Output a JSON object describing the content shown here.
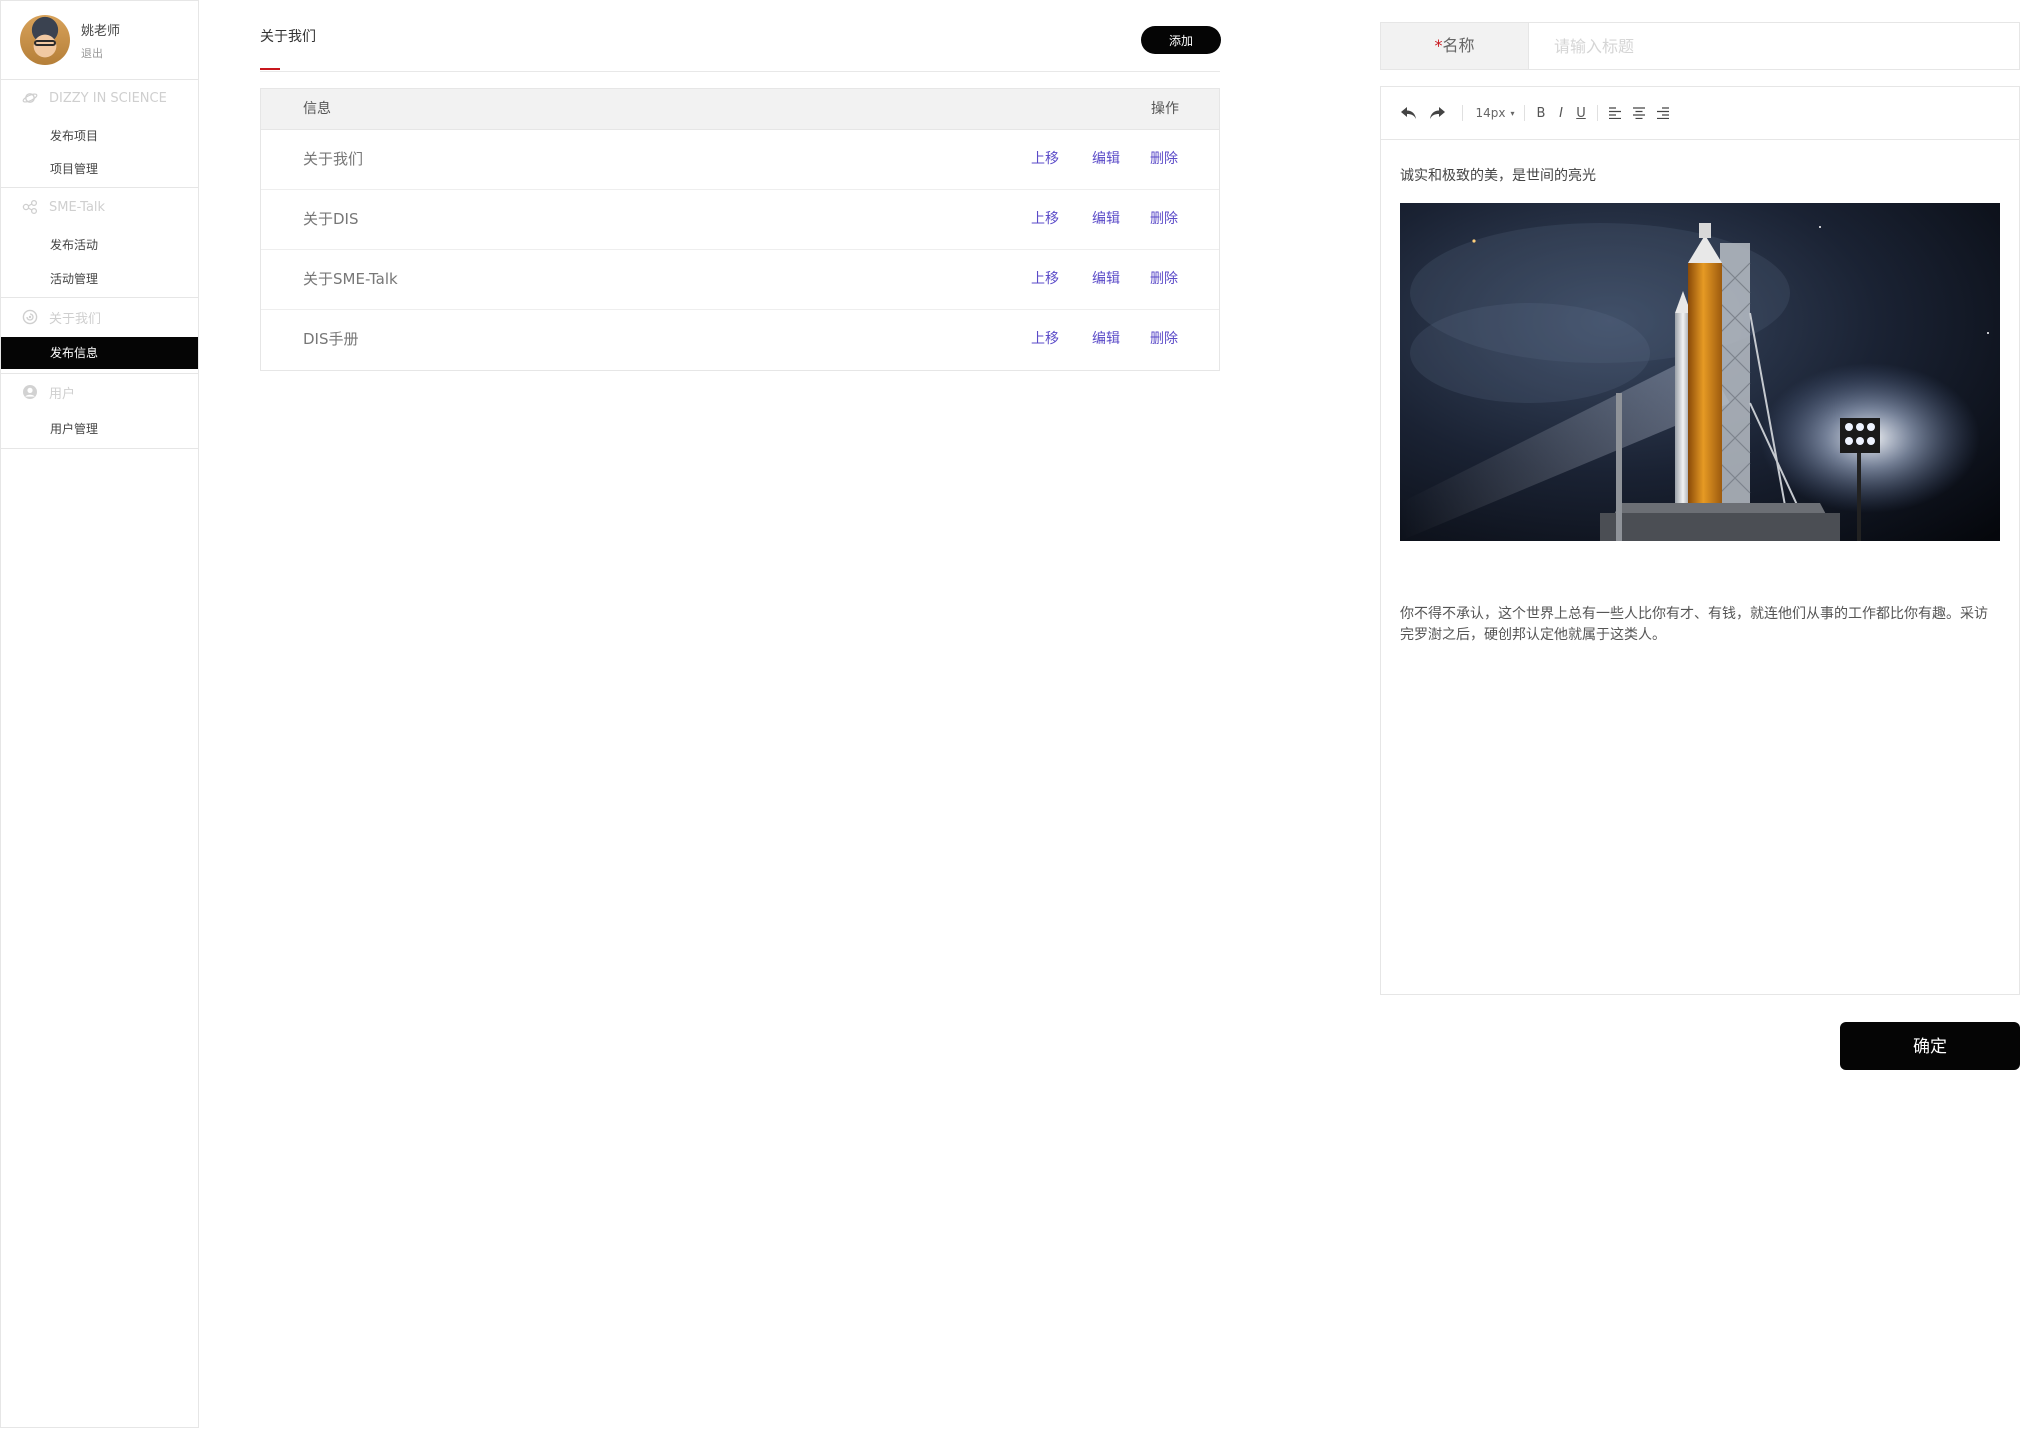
{
  "user": {
    "name": "姚老师",
    "logout": "退出"
  },
  "sidebar": {
    "sections": [
      {
        "title": "DIZZY IN SCIENCE",
        "icon": "planet-icon",
        "items": [
          {
            "label": "发布项目"
          },
          {
            "label": "项目管理"
          }
        ]
      },
      {
        "title": "SME-Talk",
        "icon": "share-icon",
        "items": [
          {
            "label": "发布活动"
          },
          {
            "label": "活动管理"
          }
        ]
      },
      {
        "title": "关于我们",
        "icon": "info-circle-icon",
        "items": [
          {
            "label": "发布信息",
            "active": true
          }
        ]
      },
      {
        "title": "用户",
        "icon": "user-icon",
        "items": [
          {
            "label": "用户管理"
          }
        ]
      }
    ]
  },
  "main": {
    "title": "关于我们",
    "add_label": "添加",
    "table": {
      "col_info": "信息",
      "col_op": "操作",
      "rows": [
        {
          "label": "关于我们",
          "up": "上移",
          "edit": "编辑",
          "delete": "删除"
        },
        {
          "label": "关于DIS",
          "up": "上移",
          "edit": "编辑",
          "delete": "删除"
        },
        {
          "label": "关于SME-Talk",
          "up": "上移",
          "edit": "编辑",
          "delete": "删除"
        },
        {
          "label": "DIS手册",
          "up": "上移",
          "edit": "编辑",
          "delete": "删除"
        }
      ]
    }
  },
  "form": {
    "name_required_mark": "*",
    "name_label": "名称",
    "name_placeholder": "请输入标题",
    "toolbar": {
      "font_size": "14px",
      "bold": "B",
      "italic": "I",
      "underline": "U"
    },
    "content_line1": "诚实和极致的美，是世间的亮光",
    "image_alt": "rocket-launch-image",
    "content_paragraph": "你不得不承认，这个世界上总有一些人比你有才、有钱，就连他们从事的工作都比你有趣。采访完罗澍之后，硬创邦认定他就属于这类人。",
    "confirm_label": "确定"
  },
  "colors": {
    "accent_red": "#c8161d",
    "link_purple": "#5b4bc8",
    "black": "#050505"
  }
}
